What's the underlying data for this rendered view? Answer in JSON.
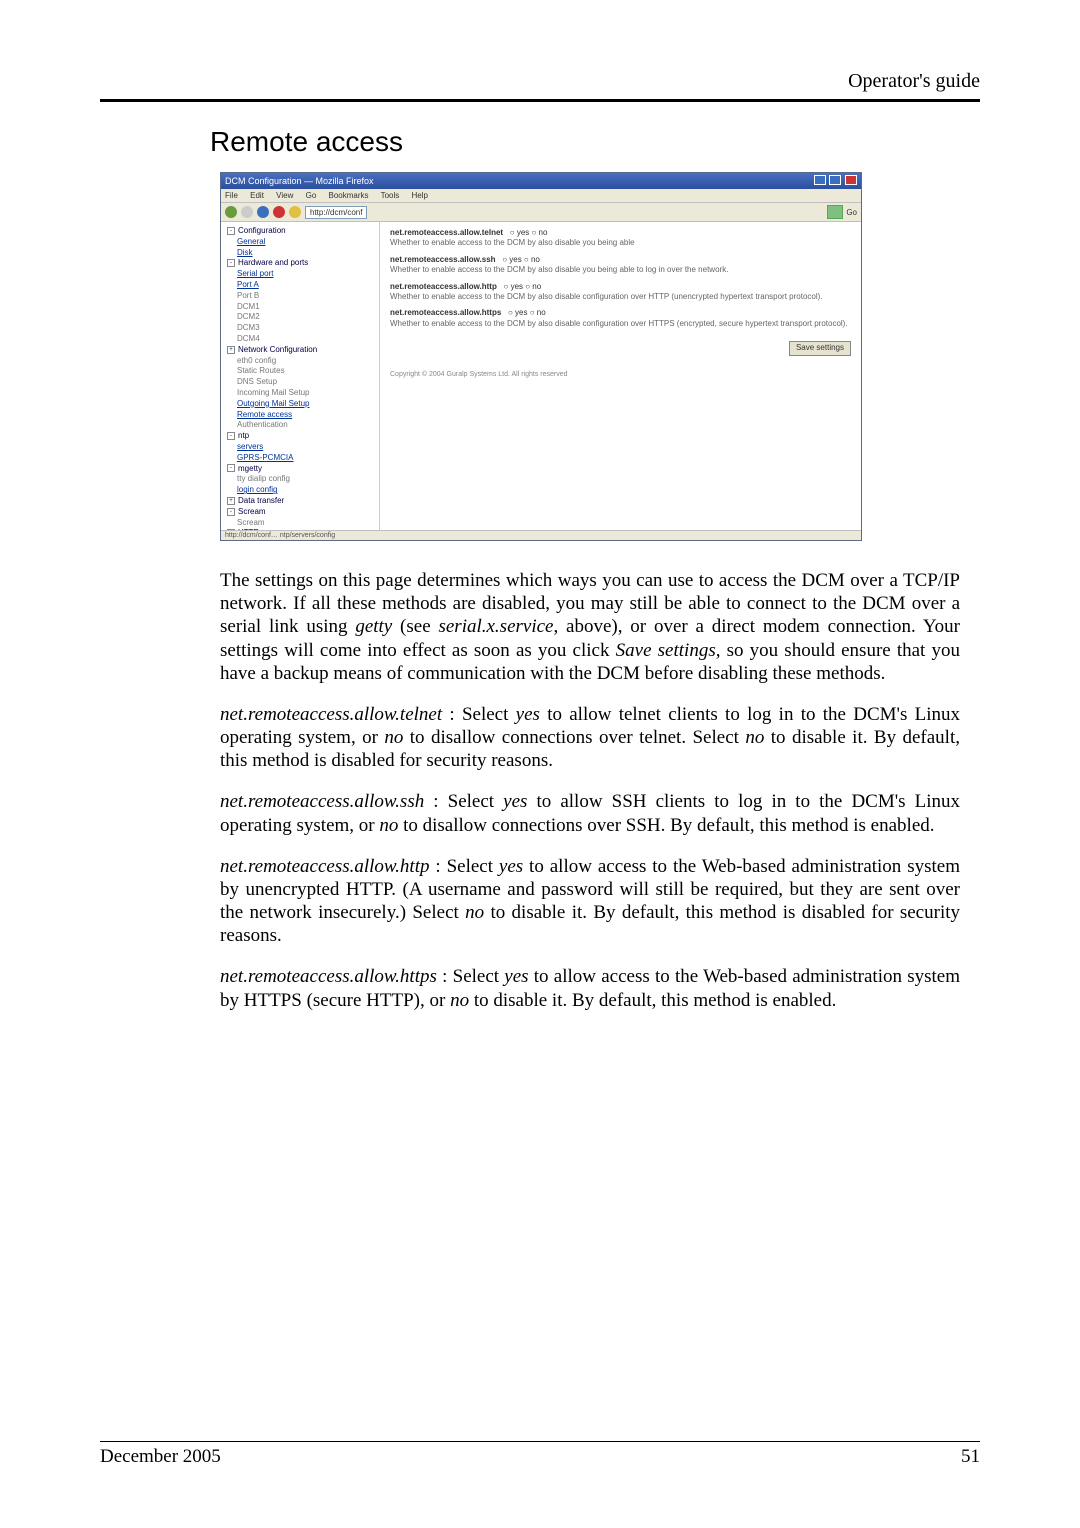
{
  "header_right": "Operator's guide",
  "section_title": "Remote access",
  "screenshot": {
    "titlebar": "DCM Configuration — Mozilla Firefox",
    "menu": [
      "File",
      "Edit",
      "View",
      "Go",
      "Bookmarks",
      "Tools",
      "Help"
    ],
    "url": "http://dcm/conf",
    "go_label": "Go",
    "tree": [
      {
        "depth": 0,
        "text": "Configuration",
        "icon": "-"
      },
      {
        "depth": 1,
        "text": "General",
        "link": true
      },
      {
        "depth": 1,
        "text": "Disk",
        "link": true
      },
      {
        "depth": 0,
        "text": "Hardware and ports",
        "icon": "-"
      },
      {
        "depth": 1,
        "text": "Serial port",
        "link": true
      },
      {
        "depth": 1,
        "text": "Port A",
        "link": true
      },
      {
        "depth": 1,
        "text": "Port B",
        "dim": true
      },
      {
        "depth": 1,
        "text": "DCM1",
        "dim": true
      },
      {
        "depth": 1,
        "text": "DCM2",
        "dim": true
      },
      {
        "depth": 1,
        "text": "DCM3",
        "dim": true
      },
      {
        "depth": 1,
        "text": "DCM4",
        "dim": true
      },
      {
        "depth": 0,
        "text": "Network Configuration",
        "icon": "+"
      },
      {
        "depth": 1,
        "text": "eth0 config",
        "dim": true
      },
      {
        "depth": 1,
        "text": "Static Routes",
        "dim": true
      },
      {
        "depth": 1,
        "text": "DNS Setup",
        "dim": true
      },
      {
        "depth": 1,
        "text": "Incoming Mail Setup",
        "dim": true
      },
      {
        "depth": 1,
        "text": "Outgoing Mail Setup",
        "link": true
      },
      {
        "depth": 1,
        "text": "Remote access",
        "link": true
      },
      {
        "depth": 1,
        "text": "Authentication",
        "dim": true
      },
      {
        "depth": 0,
        "text": "ntp",
        "icon": "-"
      },
      {
        "depth": 1,
        "text": "servers",
        "link": true
      },
      {
        "depth": 1,
        "text": "GPRS-PCMCIA",
        "link": true
      },
      {
        "depth": 0,
        "text": "mgetty",
        "icon": "-"
      },
      {
        "depth": 1,
        "text": "tty dialip config",
        "dim": true
      },
      {
        "depth": 1,
        "text": "login config",
        "link": true
      },
      {
        "depth": 0,
        "text": "Data transfer",
        "icon": "+"
      },
      {
        "depth": 0,
        "text": "Scream",
        "icon": "-"
      },
      {
        "depth": 1,
        "text": "Scream",
        "dim": true
      },
      {
        "depth": 0,
        "text": "HTTP",
        "icon": "+"
      }
    ],
    "content": {
      "items": [
        {
          "title": "net.remoteaccess.allow.telnet",
          "opts": "○ yes ○ no",
          "desc": "Whether to enable access to the DCM by      also disable you being able"
        },
        {
          "title": "net.remoteaccess.allow.ssh",
          "opts": "○ yes ○ no",
          "desc": "Whether to enable access to the DCM by      also disable you being able to log in over the network."
        },
        {
          "title": "net.remoteaccess.allow.http",
          "opts": "○ yes ○ no",
          "desc": "Whether to enable access to the DCM by      also disable configuration over HTTP (unencrypted hypertext transport protocol)."
        },
        {
          "title": "net.remoteaccess.allow.https",
          "opts": "○ yes ○ no",
          "desc": "Whether to enable access to the DCM by      also disable configuration over HTTPS (encrypted, secure hypertext transport protocol)."
        }
      ],
      "save": "Save settings",
      "footer": "Copyright © 2004 Guralp Systems Ltd. All rights reserved"
    },
    "status": "http://dcm/conf…  ntp/servers/config"
  },
  "paragraphs": {
    "p1_a": "The settings on this page determines which ways you can use to access the DCM over a TCP/IP network. If all these methods are disabled, you may still be able to connect to the DCM over a serial link using ",
    "p1_getty": "getty",
    "p1_b": " (see ",
    "p1_serial": "serial.x.service",
    "p1_c": ", above), or over a direct modem connection. Your settings will come into effect as soon as you click ",
    "p1_save": "Save settings,",
    "p1_d": " so you should ensure that you have a backup means of communication with the DCM before disabling these methods.",
    "p2_key": "net.remoteaccess.allow.telnet",
    "p2_a": " : Select ",
    "p2_yes": "yes",
    "p2_b": " to allow telnet clients to log in to the DCM's Linux operating system, or ",
    "p2_no": "no",
    "p2_c": " to disallow connections over telnet. Select ",
    "p2_no2": "no",
    "p2_d": " to disable it. By default, this method is disabled for security reasons.",
    "p3_key": "net.remoteaccess.allow.ssh",
    "p3_a": " : Select ",
    "p3_yes": "yes",
    "p3_b": " to allow SSH clients to log in to the DCM's Linux operating system, or ",
    "p3_no": "no",
    "p3_c": " to disallow connections over SSH. By default, this method is enabled.",
    "p4_key": "net.remoteaccess.allow.http",
    "p4_a": " : Select ",
    "p4_yes": "yes",
    "p4_b": " to allow access to the Web-based administration system by unencrypted HTTP. (A username and password will still be required, but they are sent over the network insecurely.) Select ",
    "p4_no": "no",
    "p4_c": " to disable it. By default, this method is disabled for security reasons.",
    "p5_key": "net.remoteaccess.allow.https",
    "p5_a": " : Select ",
    "p5_yes": "yes",
    "p5_b": " to allow access to the Web-based administration system by HTTPS (secure HTTP), or ",
    "p5_no": "no",
    "p5_c": " to disable it. By default, this method is enabled."
  },
  "footer_left": "December 2005",
  "footer_right": "51"
}
